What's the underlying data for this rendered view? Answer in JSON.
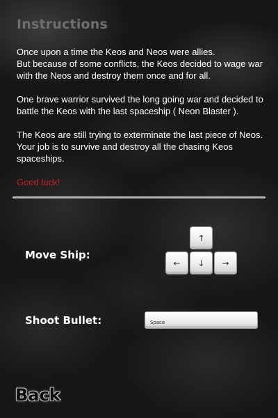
{
  "title": "Instructions",
  "story": {
    "paragraph_1_line_1": "Once upon a time the Keos and Neos were allies.",
    "paragraph_1_line_2": "But because of some conflicts, the Keos decided to wage war with the Neos and destroy them once and for all.",
    "paragraph_2": "One brave warrior survived the long going war and decided to battle the Keos with the last spaceship ( Neon Blaster ).",
    "paragraph_3_line_1": "The Keos are still trying to exterminate the last piece of Neos.",
    "paragraph_3_line_2": "Your job is to survive and destroy all the chasing Keos spaceships.",
    "good_luck": "Good luck!"
  },
  "controls": {
    "move_label": "Move Ship:",
    "shoot_label": "Shoot Bullet:",
    "keys": {
      "up": "↑",
      "left": "←",
      "down": "↓",
      "right": "→",
      "space": "Space"
    }
  },
  "back_label": "Back",
  "colors": {
    "title": "#6e6e6e",
    "text": "#ffffff",
    "good_luck": "#c0202a",
    "background": "#161616"
  }
}
